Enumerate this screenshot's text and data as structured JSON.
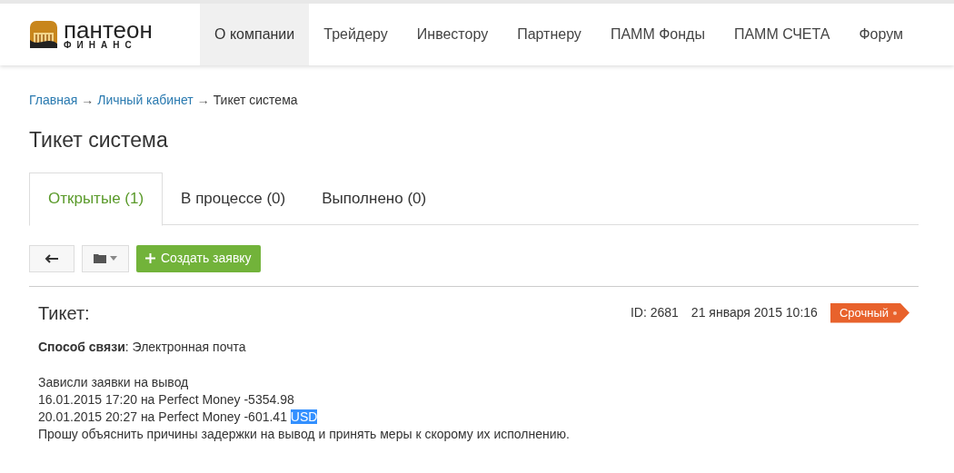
{
  "logo": {
    "name": "пантеон",
    "sub": "ФИНАНС"
  },
  "nav": [
    {
      "label": "О компании",
      "selected": true
    },
    {
      "label": "Трейдеру",
      "selected": false
    },
    {
      "label": "Инвестору",
      "selected": false
    },
    {
      "label": "Партнеру",
      "selected": false
    },
    {
      "label": "ПАММ Фонды",
      "selected": false
    },
    {
      "label": "ПАММ СЧЕТА",
      "selected": false
    },
    {
      "label": "Форум",
      "selected": false
    }
  ],
  "breadcrumbs": [
    {
      "label": "Главная",
      "kind": "link"
    },
    {
      "label": "→",
      "kind": "separator"
    },
    {
      "label": "Личный кабинет",
      "kind": "link"
    },
    {
      "label": "→",
      "kind": "separator"
    },
    {
      "label": "Тикет система",
      "kind": "current"
    }
  ],
  "page_title": "Тикет система",
  "tabs": [
    {
      "label": "Открытые (1)",
      "selected": true
    },
    {
      "label": "В процессе (0)",
      "selected": false
    },
    {
      "label": "Выполнено (0)",
      "selected": false
    }
  ],
  "toolbar": {
    "create_button": "Создать заявку"
  },
  "ticket": {
    "title": "Тикет:",
    "id": "ID: 2681",
    "date": "21 января 2015 10:16",
    "badge": "Срочный",
    "contact_label": "Способ связи",
    "contact_value": ": Электронная почта",
    "lines": [
      {
        "text": "Зависли заявки на вывод"
      },
      {
        "text": "16.01.2015 17:20 на Perfect Money -5354.98"
      },
      {
        "text": "20.01.2015 20:27 на Perfect Money -601.41 ",
        "selected_text": "USD"
      },
      {
        "text": "Прошу объяснить причины задержки на вывод и принять меры к скорому их исполнению."
      }
    ]
  }
}
